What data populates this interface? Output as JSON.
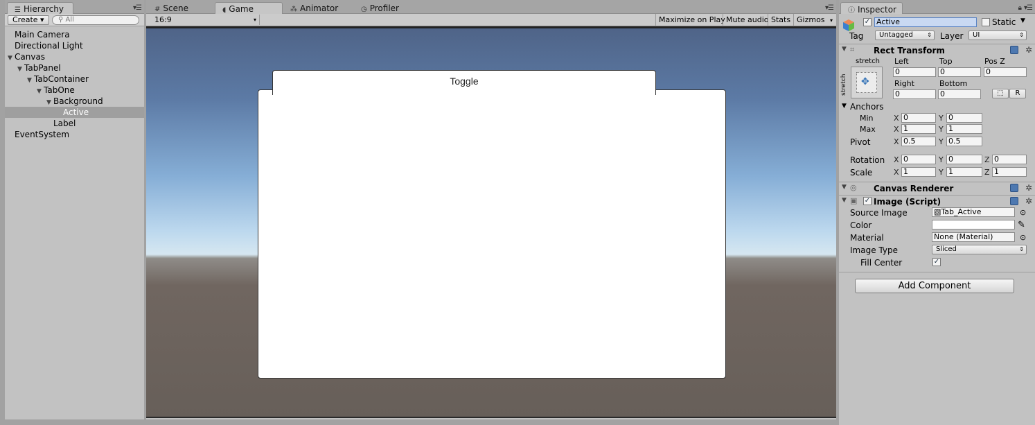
{
  "hierarchy": {
    "tab_label": "Hierarchy",
    "create_label": "Create ▾",
    "search_placeholder": "All",
    "items": [
      {
        "label": "Main Camera",
        "depth": 0,
        "expander": ""
      },
      {
        "label": "Directional Light",
        "depth": 0,
        "expander": ""
      },
      {
        "label": "Canvas",
        "depth": 0,
        "expander": "▼"
      },
      {
        "label": "TabPanel",
        "depth": 1,
        "expander": "▼"
      },
      {
        "label": "TabContainer",
        "depth": 2,
        "expander": "▼"
      },
      {
        "label": "TabOne",
        "depth": 3,
        "expander": "▼"
      },
      {
        "label": "Background",
        "depth": 4,
        "expander": "▼"
      },
      {
        "label": "Active",
        "depth": 5,
        "expander": "",
        "selected": true
      },
      {
        "label": "Label",
        "depth": 4,
        "expander": ""
      },
      {
        "label": "EventSystem",
        "depth": 0,
        "expander": ""
      }
    ]
  },
  "game": {
    "tabs": [
      {
        "label": "Scene",
        "icon": "grid-icon"
      },
      {
        "label": "Game",
        "icon": "pacman-icon"
      },
      {
        "label": "Animator",
        "icon": "animator-icon"
      },
      {
        "label": "Profiler",
        "icon": "profiler-icon"
      }
    ],
    "aspect": "16:9",
    "toolbar": {
      "maximize": "Maximize on Play",
      "mute": "Mute audio",
      "stats": "Stats",
      "gizmos": "Gizmos"
    },
    "toggle_label": "Toggle"
  },
  "inspector": {
    "tab_label": "Inspector",
    "object_name": "Active",
    "static_label": "Static",
    "tag_label": "Tag",
    "tag_value": "Untagged",
    "layer_label": "Layer",
    "layer_value": "UI",
    "rect_transform": {
      "title": "Rect Transform",
      "stretch_h": "stretch",
      "stretch_v": "stretch",
      "left_label": "Left",
      "top_label": "Top",
      "posz_label": "Pos Z",
      "left": "0",
      "top": "0",
      "posz": "0",
      "right_label": "Right",
      "bottom_label": "Bottom",
      "right": "0",
      "bottom": "0",
      "r_button": "R",
      "anchors_label": "Anchors",
      "min_label": "Min",
      "max_label": "Max",
      "min_x": "0",
      "min_y": "0",
      "max_x": "1",
      "max_y": "1",
      "pivot_label": "Pivot",
      "pivot_x": "0.5",
      "pivot_y": "0.5",
      "rotation_label": "Rotation",
      "rot_x": "0",
      "rot_y": "0",
      "rot_z": "0",
      "scale_label": "Scale",
      "scale_x": "1",
      "scale_y": "1",
      "scale_z": "1",
      "x": "X",
      "y": "Y",
      "z": "Z"
    },
    "canvas_renderer": {
      "title": "Canvas Renderer"
    },
    "image_script": {
      "title": "Image (Script)",
      "source_image_label": "Source Image",
      "source_image_value": "Tab_Active",
      "color_label": "Color",
      "material_label": "Material",
      "material_value": "None (Material)",
      "image_type_label": "Image Type",
      "image_type_value": "Sliced",
      "fill_center_label": "Fill Center"
    },
    "add_component": "Add Component"
  }
}
